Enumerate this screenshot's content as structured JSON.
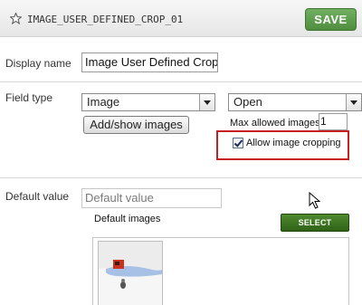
{
  "header": {
    "field_id": "IMAGE_USER_DEFINED_CROP_01",
    "save_label": "SAVE"
  },
  "display_name": {
    "label": "Display name",
    "value": "Image User Defined Crop"
  },
  "field_type": {
    "label": "Field type",
    "type_value": "Image",
    "mode_value": "Open",
    "add_images_label": "Add/show images",
    "max_images_label": "Max allowed images:",
    "max_images_value": "1",
    "allow_cropping_label": "Allow image cropping",
    "allow_cropping_checked": true
  },
  "default_value": {
    "label": "Default value",
    "placeholder": "Default value",
    "images_label": "Default images",
    "select_images_label": "SELECT IMAGES"
  },
  "colors": {
    "save_green": "#5a9b48",
    "highlight_red": "#c82020",
    "select_images_green": "#3d7322"
  }
}
